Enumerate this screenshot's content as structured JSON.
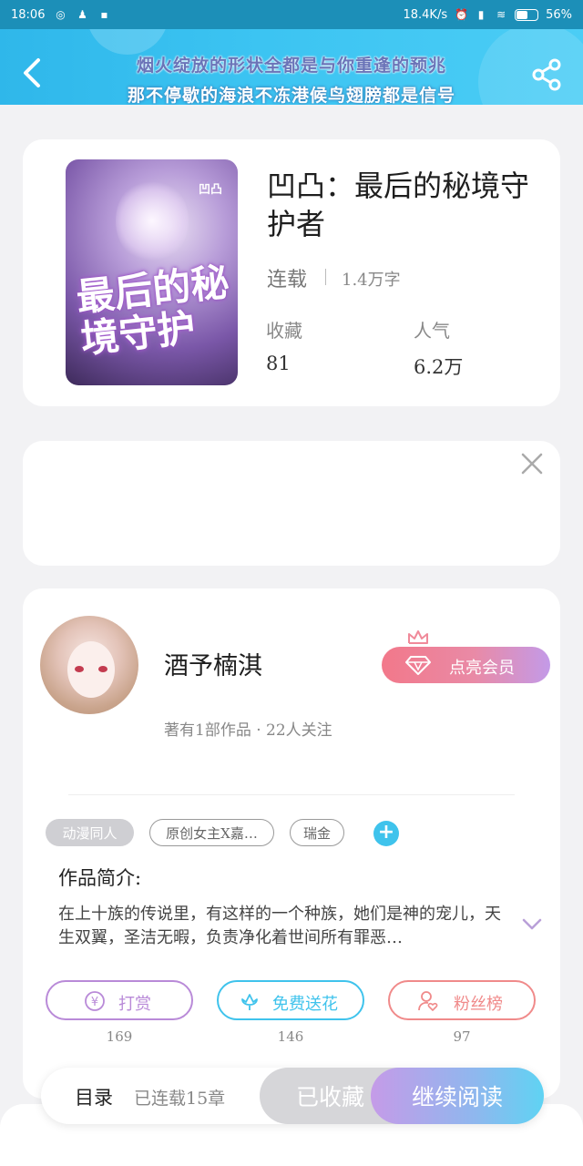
{
  "status_bar": {
    "time": "18:06",
    "network_speed": "18.4K/s",
    "battery_percent": "56%",
    "battery_level": 0.56
  },
  "header": {
    "lyric_line1": "烟火绽放的形状全都是与你重逢的预兆",
    "lyric_line2": "那不停歇的海浪不冻港候鸟翅膀都是信号",
    "gradient_start": "#2fb7ea",
    "gradient_end": "#4bcdf5",
    "back_icon": "chevron-left-icon",
    "share_icon": "share-icon"
  },
  "book": {
    "title": "凹凸：最后的秘境守护者",
    "status": "连载",
    "word_count": "1.4万字",
    "stats": [
      {
        "label": "收藏",
        "value": "81"
      },
      {
        "label": "人气",
        "value": "6.2万"
      }
    ],
    "cover_text": "最后的秘境守护",
    "cover_tag": "凹凸"
  },
  "ad_card": {
    "close_icon": "close-icon"
  },
  "author": {
    "name": "酒予楠淇",
    "meta": "著有1部作品 · 22人关注",
    "vip_button": "点亮会员",
    "vip_icon": "diamond-icon",
    "crown_icon": "crown-icon"
  },
  "tags": [
    "动漫同人",
    "原创女主X嘉…",
    "瑞金"
  ],
  "intro": {
    "title": "作品简介:",
    "text": "在上十族的传说里，有这样的一个种族，她们是神的宠儿，天生双翼，圣洁无暇，负责净化着世间所有罪恶…"
  },
  "actions": [
    {
      "label": "打赏",
      "count": "169",
      "color": "#b98ad8",
      "icon": "yen-coin-icon"
    },
    {
      "label": "免费送花",
      "count": "146",
      "color": "#3fc3ec",
      "icon": "flower-icon"
    },
    {
      "label": "粉丝榜",
      "count": "97",
      "color": "#f08a8a",
      "icon": "user-heart-icon"
    }
  ],
  "bottom": {
    "catalog_label": "目录",
    "catalog_count": "已连载15章",
    "fav_button": "已收藏",
    "read_button": "继续阅读"
  }
}
